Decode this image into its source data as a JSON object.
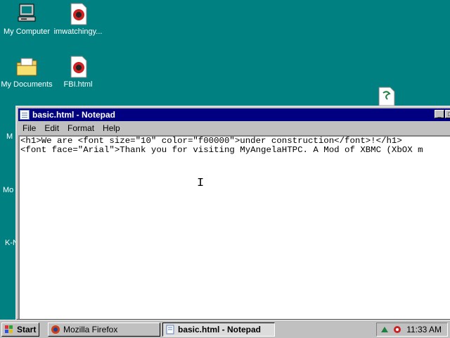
{
  "desktop": {
    "icons": [
      {
        "label": "My Computer"
      },
      {
        "label": "imwatchingy..."
      },
      {
        "label": "My Documents"
      },
      {
        "label": "FBI.html"
      }
    ],
    "partial_labels": [
      "M",
      "Mo",
      "K-N"
    ]
  },
  "window": {
    "title": "basic.html - Notepad",
    "menu": [
      "File",
      "Edit",
      "Format",
      "Help"
    ],
    "lines": [
      "<h1>We are <font size=\"10\" color=\"f00000\">under construction</font>!</h1>",
      "<font face=\"Arial\">Thank you for visiting MyAngelaHTPC. A Mod of XBMC (XbOX m"
    ]
  },
  "taskbar": {
    "start_label": "Start",
    "tasks": [
      "Mozilla Firefox",
      "basic.html - Notepad"
    ],
    "clock": "11:33 AM"
  },
  "colors": {
    "desktop": "#008080",
    "titlebar": "#000080",
    "face": "#c0c0c0"
  }
}
